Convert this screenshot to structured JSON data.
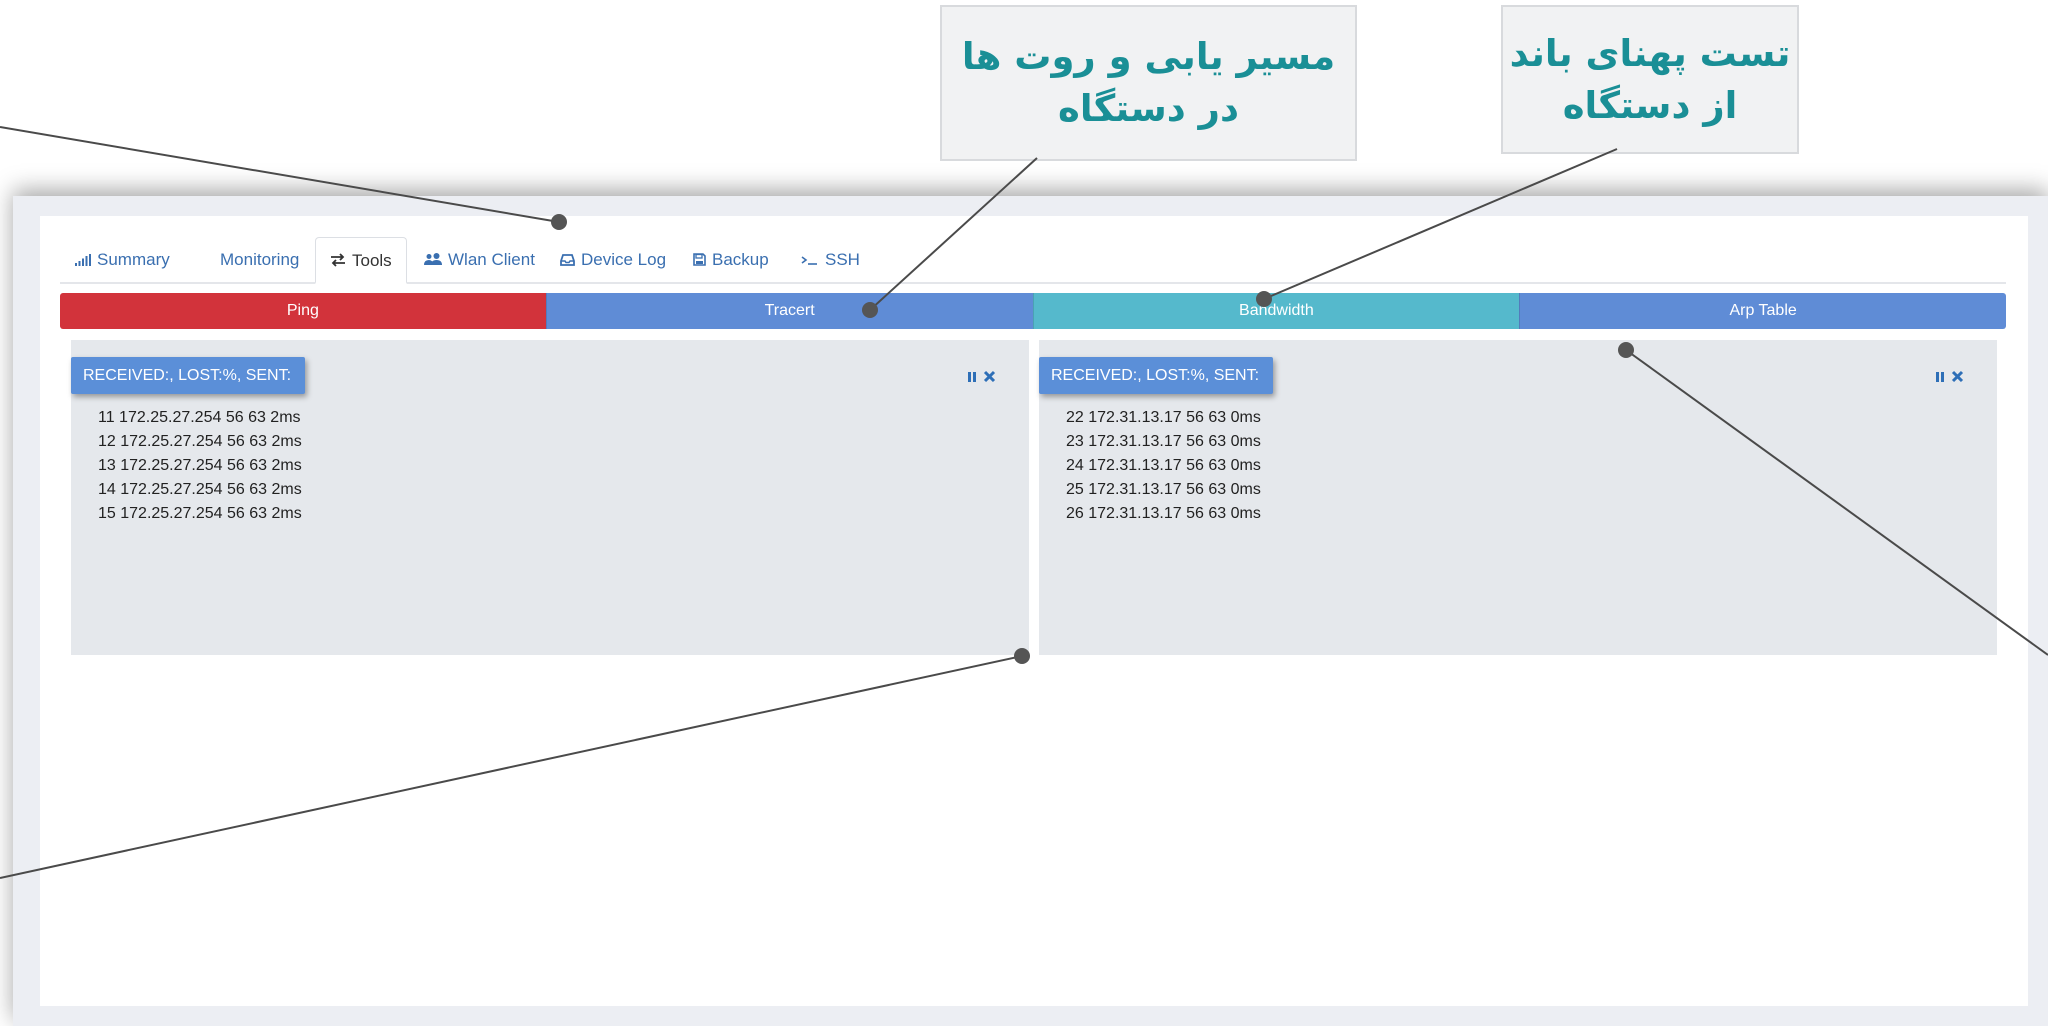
{
  "tabs": [
    {
      "label": "Summary",
      "icon": "signal-bars-icon"
    },
    {
      "label": "Monitoring",
      "icon": ""
    },
    {
      "label": "Tools",
      "icon": "exchange-arrows-icon",
      "active": true
    },
    {
      "label": "Wlan Client",
      "icon": "users-icon"
    },
    {
      "label": "Device Log",
      "icon": "inbox-icon"
    },
    {
      "label": "Backup",
      "icon": "floppy-disk-icon"
    },
    {
      "label": "SSH",
      "icon": "terminal-icon"
    }
  ],
  "tools": [
    {
      "label": "Ping",
      "color": "#d2333b"
    },
    {
      "label": "Tracert",
      "color": "#5f8cd6"
    },
    {
      "label": "Bandwidth",
      "color": "#55b9cc"
    },
    {
      "label": "Arp Table",
      "color": "#5f8cd6"
    }
  ],
  "panels": [
    {
      "badge": "RECEIVED:, LOST:%, SENT:",
      "lines": [
        "11 172.25.27.254 56 63 2ms",
        "12 172.25.27.254 56 63 2ms",
        "13 172.25.27.254 56 63 2ms",
        "14 172.25.27.254 56 63 2ms",
        "15 172.25.27.254 56 63 2ms"
      ]
    },
    {
      "badge": "RECEIVED:, LOST:%, SENT:",
      "lines": [
        "22 172.31.13.17 56 63 0ms",
        "23 172.31.13.17 56 63 0ms",
        "24 172.31.13.17 56 63 0ms",
        "25 172.31.13.17 56 63 0ms",
        "26 172.31.13.17 56 63 0ms"
      ]
    }
  ],
  "callouts": {
    "tracert_line1": "مسیر یابی و روت ها",
    "tracert_line2": "در دستگاه",
    "bandwidth_line1": "تست پهنای باند",
    "bandwidth_line2": "از دستگاه"
  },
  "colors": {
    "accent_blue": "#3a6fb0",
    "callout_text": "#1a8f96",
    "badge": "#5b8fd8"
  }
}
